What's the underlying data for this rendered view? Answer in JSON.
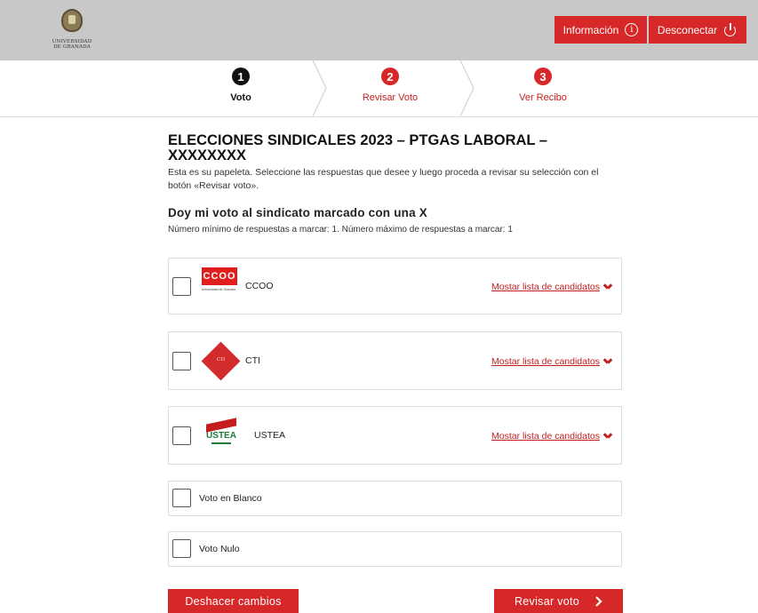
{
  "header": {
    "logo_line1": "Universidad",
    "logo_line2": "de Granada",
    "info_label": "Información",
    "logout_label": "Desconectar",
    "accent": "#d62828"
  },
  "steps": [
    {
      "num": "1",
      "label": "Voto",
      "active": true
    },
    {
      "num": "2",
      "label": "Revisar Voto",
      "active": false
    },
    {
      "num": "3",
      "label": "Ver Recibo",
      "active": false
    }
  ],
  "ballot": {
    "title": "ELECCIONES SINDICALES 2023 – PTGAS LABORAL – XXXXXXXX",
    "intro": "Esta es su papeleta. Seleccione las respuestas que desee y luego proceda a revisar su selección con el botón «Revisar voto».",
    "question": "Doy mi voto al sindicato marcado con una X",
    "rules": "Número mínimo de respuestas a marcar: 1. Número máximo de respuestas a marcar: 1",
    "candidates_label": "Mostar lista de candidatos",
    "options": [
      {
        "label": "CCOO",
        "logo": "CCOO",
        "logo_sub": "Universidad de Granada"
      },
      {
        "label": "CTI",
        "logo": "CTI"
      },
      {
        "label": "USTEA",
        "logo": "USTEA"
      },
      {
        "label": "Voto en Blanco"
      },
      {
        "label": "Voto Nulo"
      }
    ]
  },
  "actions": {
    "undo_label": "Deshacer cambios",
    "review_label": "Revisar voto"
  }
}
